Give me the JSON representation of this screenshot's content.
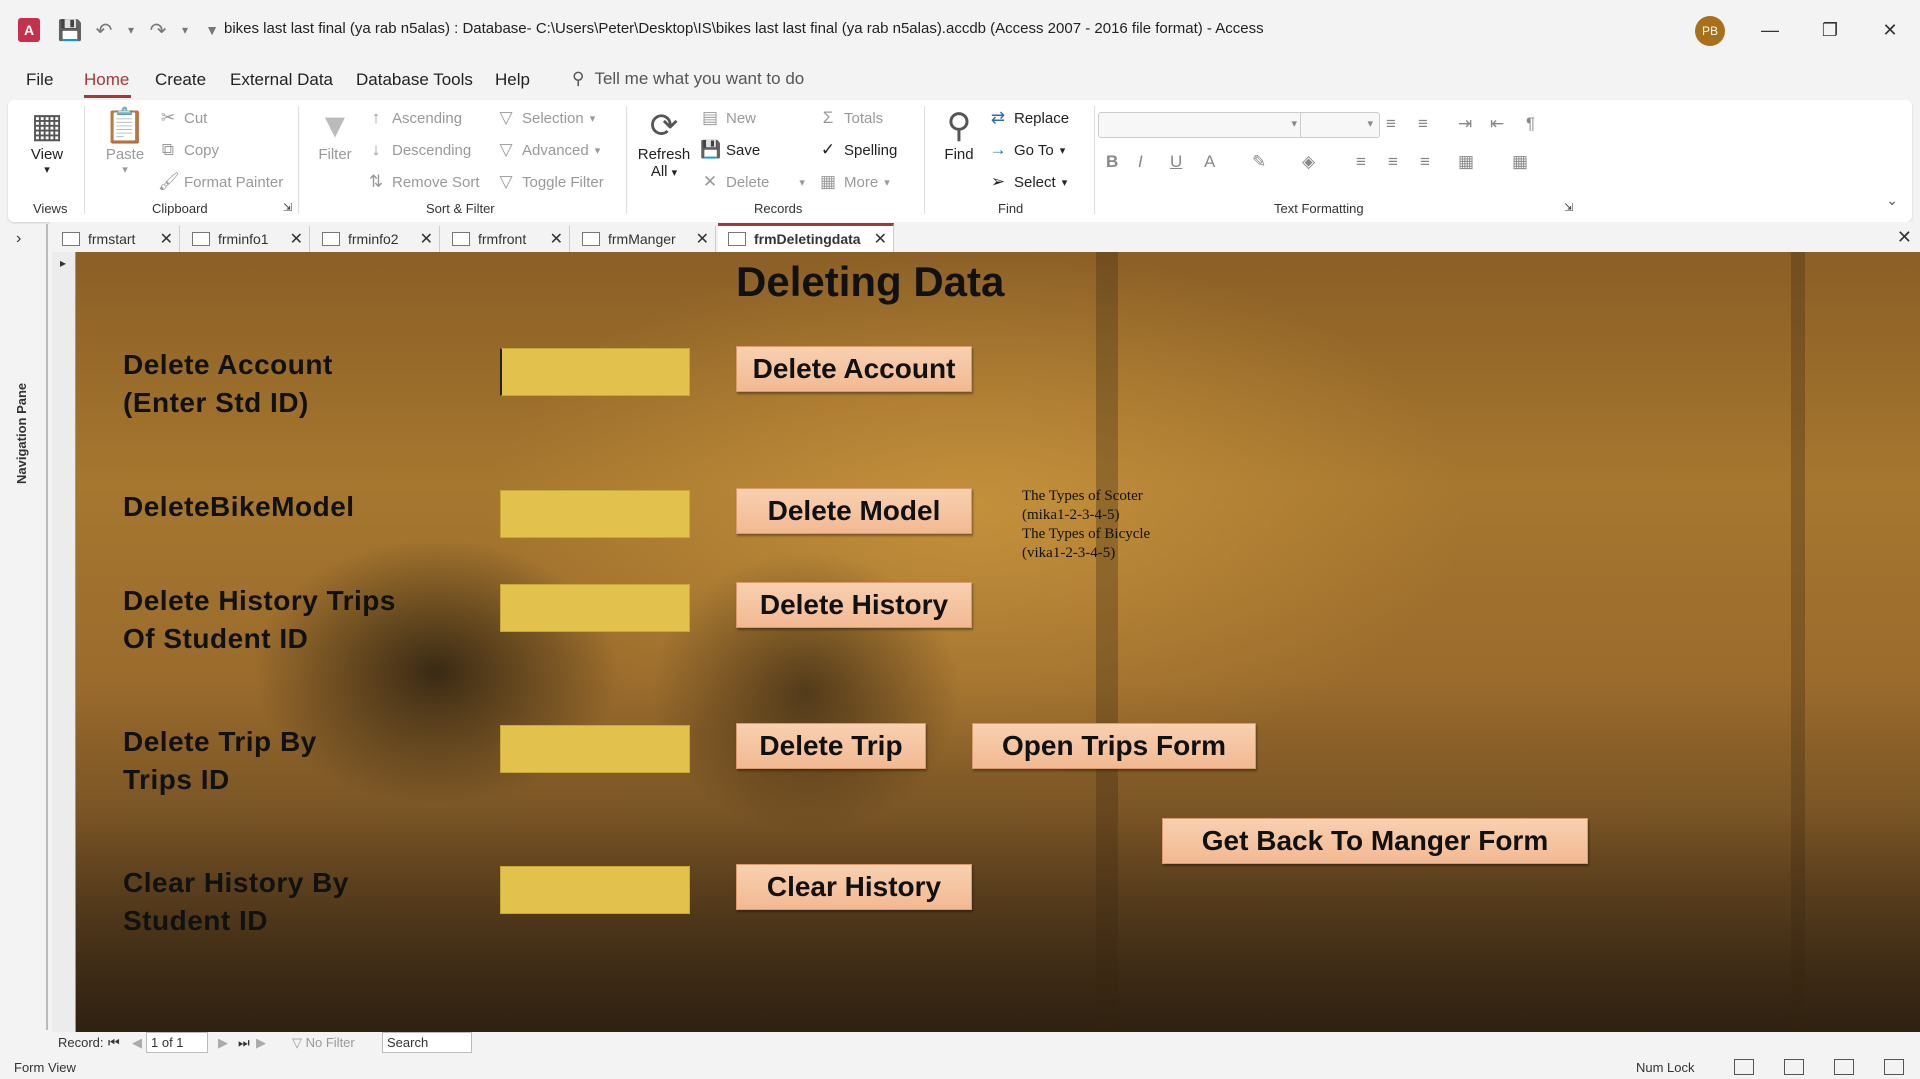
{
  "window": {
    "title": "bikes last last final (ya rab n5alas) : Database- C:\\Users\\Peter\\Desktop\\IS\\bikes last last final (ya rab n5alas).accdb (Access 2007 - 2016 file format)  -  Access",
    "app_logo": "A",
    "avatar": "PB"
  },
  "menu": {
    "items": [
      "File",
      "Home",
      "Create",
      "External Data",
      "Database Tools",
      "Help"
    ],
    "tell_me": "Tell me what you want to do"
  },
  "ribbon": {
    "views": {
      "view": "View",
      "group": "Views"
    },
    "clipboard": {
      "paste": "Paste",
      "cut": "Cut",
      "copy": "Copy",
      "format_painter": "Format Painter",
      "group": "Clipboard"
    },
    "sort_filter": {
      "filter": "Filter",
      "ascending": "Ascending",
      "descending": "Descending",
      "remove_sort": "Remove Sort",
      "selection": "Selection",
      "advanced": "Advanced",
      "toggle_filter": "Toggle Filter",
      "group": "Sort & Filter"
    },
    "records": {
      "refresh": "Refresh",
      "refresh_all": "All",
      "new": "New",
      "save": "Save",
      "delete": "Delete",
      "totals": "Totals",
      "spelling": "Spelling",
      "more": "More",
      "group": "Records"
    },
    "find": {
      "find": "Find",
      "replace": "Replace",
      "go_to": "Go To",
      "select": "Select",
      "group": "Find"
    },
    "text_formatting": {
      "group": "Text Formatting"
    }
  },
  "nav_pane": {
    "label": "Navigation Pane"
  },
  "doc_tabs": [
    "frmstart",
    "frminfo1",
    "frminfo2",
    "frmfront",
    "frmManger",
    "frmDeletingdata"
  ],
  "active_tab": "frmDeletingdata",
  "form": {
    "title": "Deleting Data",
    "rows": [
      {
        "label_1": "Delete Account",
        "label_2": "(Enter Std ID)",
        "button": "Delete Account"
      },
      {
        "label_1": "DeleteBikeModel",
        "label_2": "",
        "button": "Delete Model"
      },
      {
        "label_1": "Delete History Trips",
        "label_2": "Of Student ID",
        "button": "Delete History"
      },
      {
        "label_1": "Delete Trip By",
        "label_2": "Trips ID",
        "button": "Delete Trip"
      },
      {
        "label_1": "Clear History By",
        "label_2": "Student ID",
        "button": "Clear History"
      }
    ],
    "open_trips_button": "Open Trips Form",
    "back_button": "Get Back To Manger Form",
    "note_lines": [
      "The Types of Scoter",
      "(mika1-2-3-4-5)",
      "The Types of Bicycle",
      "(vika1-2-3-4-5)"
    ]
  },
  "record_nav": {
    "record_label": "Record:",
    "position": "1 of 1",
    "no_filter": "No Filter",
    "search": "Search"
  },
  "status": {
    "left": "Form View",
    "num_lock": "Num Lock"
  },
  "colors": {
    "accent": "#a4373a",
    "input_fill": "#e2c14c",
    "button_fill": "#f2b992"
  }
}
